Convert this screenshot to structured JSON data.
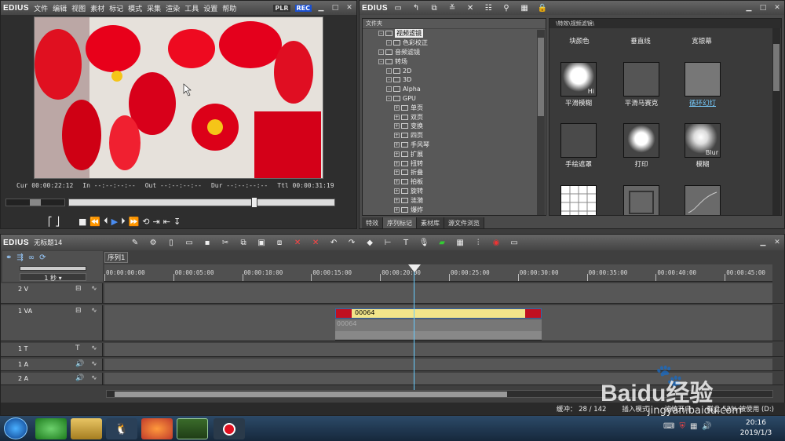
{
  "player": {
    "logo": "EDIUS",
    "menu": [
      "文件",
      "编辑",
      "视图",
      "素材",
      "标记",
      "模式",
      "采集",
      "渲染",
      "工具",
      "设置",
      "帮助"
    ],
    "plr": "PLR",
    "rec": "REC",
    "cur_label": "Cur",
    "cur": "00:00:22:12",
    "in_label": "In",
    "in": "--:--:--:--",
    "out_label": "Out",
    "out": "--:--:--:--",
    "dur_label": "Dur",
    "dur": "--:--:--:--",
    "ttl_label": "Ttl",
    "ttl": "00:00:31:19"
  },
  "effects": {
    "logo": "EDIUS",
    "tree_header": "文件夹",
    "tree": [
      {
        "label": "视频滤镜",
        "indent": 1,
        "selected": true
      },
      {
        "label": "色彩校正",
        "indent": 2
      },
      {
        "label": "音频滤镜",
        "indent": 1
      },
      {
        "label": "转场",
        "indent": 1
      },
      {
        "label": "2D",
        "indent": 2
      },
      {
        "label": "3D",
        "indent": 2
      },
      {
        "label": "Alpha",
        "indent": 2
      },
      {
        "label": "GPU",
        "indent": 2
      },
      {
        "label": "单页",
        "indent": 3
      },
      {
        "label": "双页",
        "indent": 3
      },
      {
        "label": "变换",
        "indent": 3
      },
      {
        "label": "四页",
        "indent": 3
      },
      {
        "label": "手风琴",
        "indent": 3
      },
      {
        "label": "扩展",
        "indent": 3
      },
      {
        "label": "扭转",
        "indent": 3
      },
      {
        "label": "折叠",
        "indent": 3
      },
      {
        "label": "拍板",
        "indent": 3
      },
      {
        "label": "旋转",
        "indent": 3
      },
      {
        "label": "涟漪",
        "indent": 3
      },
      {
        "label": "爆炸",
        "indent": 3
      }
    ],
    "path": "\\特效\\视频滤镜\\",
    "thumbs_top_labels": [
      "块颜色",
      "垂直线",
      "宽银幕"
    ],
    "thumbs": [
      {
        "label": "平滑模糊",
        "badge": "Hi"
      },
      {
        "label": "平滑马赛克",
        "badge": ""
      },
      {
        "label": "循环幻灯",
        "badge": "",
        "selected": true
      },
      {
        "label": "手绘遮罩",
        "badge": ""
      },
      {
        "label": "打印",
        "badge": ""
      },
      {
        "label": "模糊",
        "badge": "Blur"
      }
    ],
    "tabs": [
      "特效",
      "序列标记",
      "素材库",
      "源文件浏览"
    ]
  },
  "timeline": {
    "logo": "EDIUS",
    "project": "无标题14",
    "sequence_tab": "序列1",
    "scale": "1 秒",
    "ruler": [
      "00:00:00:00",
      "00:00:05:00",
      "00:00:10:00",
      "00:00:15:00",
      "00:00:20:00",
      "00:00:25:00",
      "00:00:30:00",
      "00:00:35:00",
      "00:00:40:00",
      "00:00:45:00"
    ],
    "tracks": [
      {
        "name": "2 V"
      },
      {
        "name": "1 VA"
      },
      {
        "name": "1 T"
      },
      {
        "name": "1 A"
      },
      {
        "name": "2 A"
      }
    ],
    "clip_name": "00064",
    "clip_audio_name": "00064",
    "status": {
      "buffer": "缓冲：  28 / 142",
      "mode": "插入模式",
      "ripple": "波纹开启",
      "disk": "磁盘 52% 被使用 (D:)"
    }
  },
  "taskbar": {
    "time": "20:16",
    "date": "2019/1/3"
  },
  "watermark": {
    "brand": "Baidu经验",
    "url": "jingyan.baidu.com"
  }
}
